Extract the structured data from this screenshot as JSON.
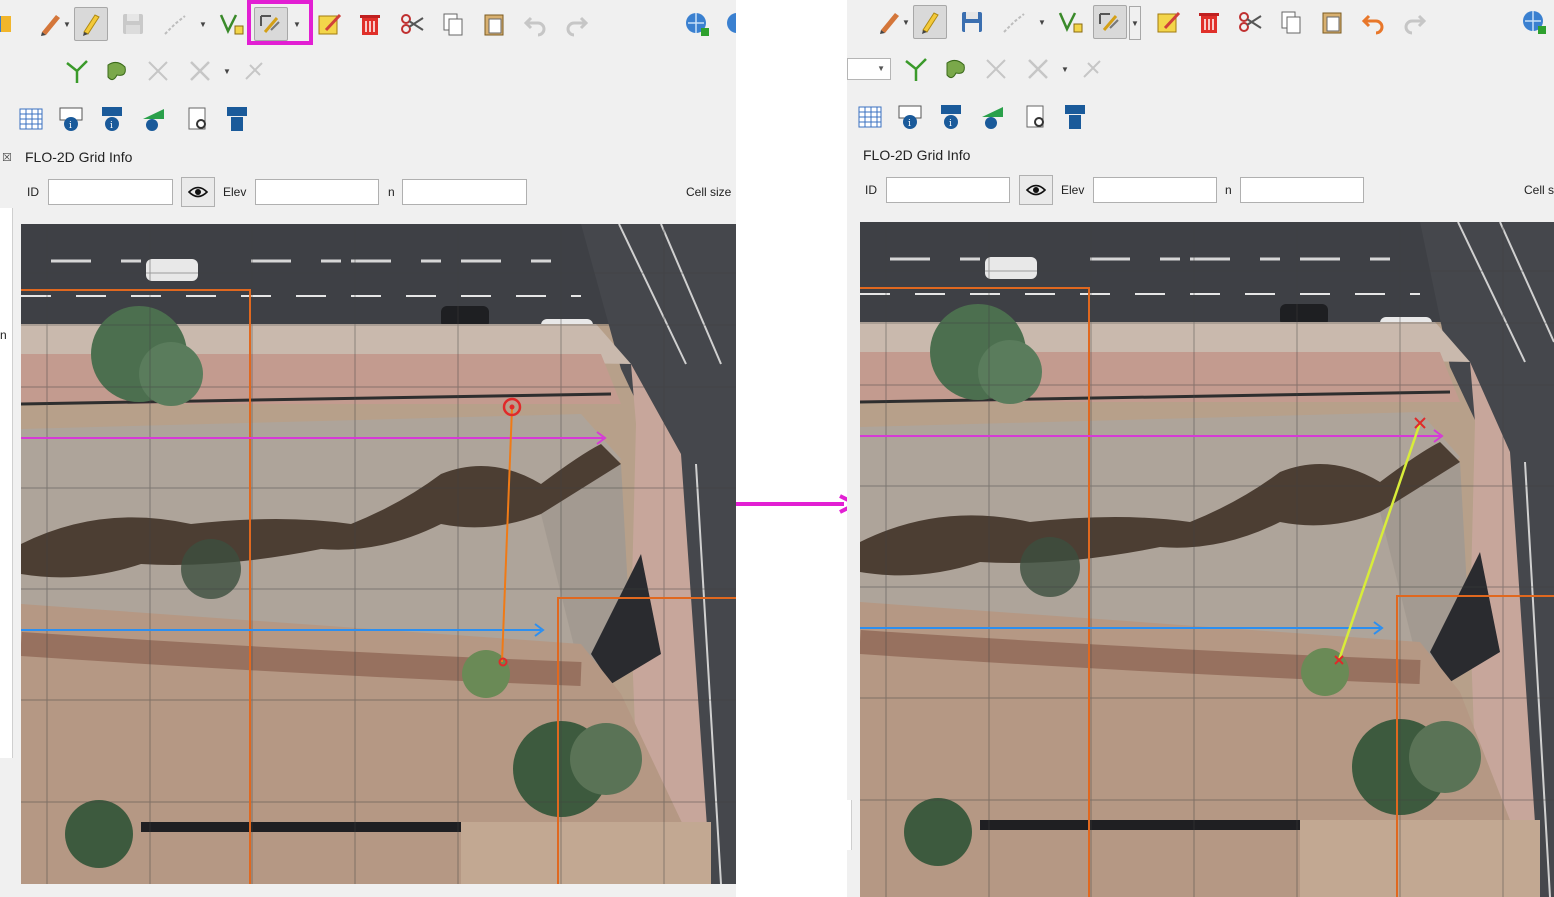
{
  "grid_info": {
    "title": "FLO-2D Grid Info",
    "id_label": "ID",
    "elev_label": "Elev",
    "n_label": "n",
    "cell_size_label": "Cell size",
    "cell_size_label_cropped": "Cell s",
    "side_letter": "n",
    "id_value": "",
    "elev_value": "",
    "n_value": ""
  },
  "toolbar_digitizing": [
    "current-edits-icon",
    "toggle-editing-icon",
    "save-edits-icon",
    "digitize-line-icon",
    "vertex-tool-icon",
    "schematize-tool-icon",
    "modify-attributes-icon",
    "delete-selected-icon",
    "cut-features-icon",
    "copy-features-icon",
    "paste-features-icon",
    "undo-icon",
    "redo-icon",
    "add-wms-layer-icon"
  ],
  "toolbar_advanced": [
    "reshape-icon",
    "split-features-icon",
    "delete-part-icon",
    "offset-icon",
    "trim-icon"
  ],
  "toolbar_flo2d": [
    "attribute-table-icon",
    "grid-info-icon",
    "flo-info-icon",
    "profile-info-icon",
    "identify-icon",
    "flo-help-icon"
  ],
  "colors": {
    "highlight": "#e21fd3",
    "connector_before": "#f07a16",
    "connector_after": "#d8ec3a",
    "cross_section_top": "#d63ad6",
    "cross_section_bottom": "#2c8ff0",
    "grid_cells": "#e0681f",
    "marker": "#e02a2a"
  }
}
